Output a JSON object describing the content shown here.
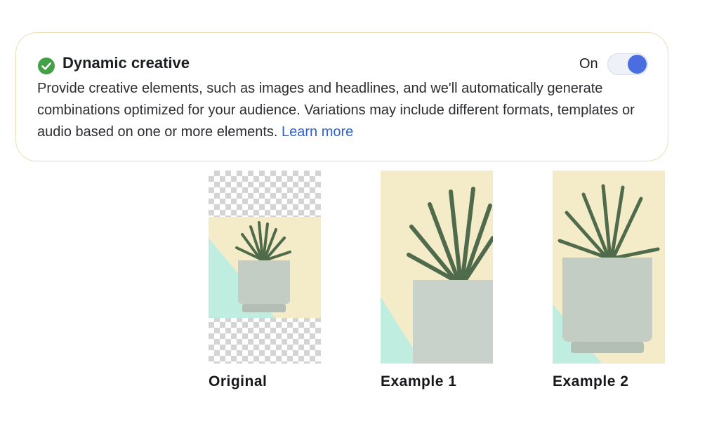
{
  "card": {
    "status_icon": "check-circle-icon",
    "title": "Dynamic creative",
    "toggle_label": "On",
    "toggle_state": "on",
    "description": "Provide creative elements, such as images and headlines, and we'll automatically generate combinations optimized for your audience. Variations may include different formats, templates or audio based on one or more elements.",
    "learn_more": "Learn more"
  },
  "examples": [
    {
      "caption": "Original"
    },
    {
      "caption": "Example 1"
    },
    {
      "caption": "Example 2"
    }
  ],
  "colors": {
    "check_green": "#43a047",
    "toggle_blue": "#4a6ee0",
    "link_blue": "#2c62d2",
    "card_border": "#eedcb5",
    "photo_background": "#f4ecc9",
    "photo_accent": "#bfeee0",
    "pot": "#c3cdc4",
    "leaves": "#4f6b4b"
  }
}
